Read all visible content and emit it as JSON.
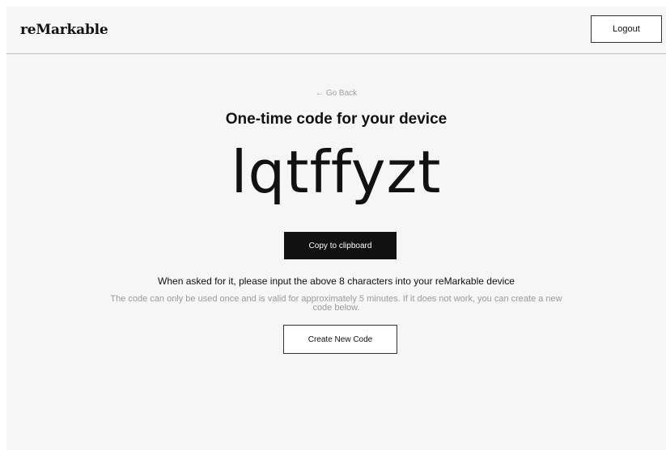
{
  "header": {
    "logo": "reMarkable",
    "logout_label": "Logout"
  },
  "main": {
    "go_back_arrow": "←",
    "go_back_label": "Go Back",
    "title": "One-time code for your device",
    "code": "lqtffyzt",
    "copy_label": "Copy to clipboard",
    "instructions": "When asked for it, please input the above 8 characters into your reMarkable device",
    "note": "The code can only be used once and is valid for approximately 5 minutes. If it does not work, you can create a new code below.",
    "create_label": "Create New Code"
  },
  "colors": {
    "background": "#f6f6f6",
    "primary_button": "#111111",
    "muted_text": "#9a9a9a"
  }
}
